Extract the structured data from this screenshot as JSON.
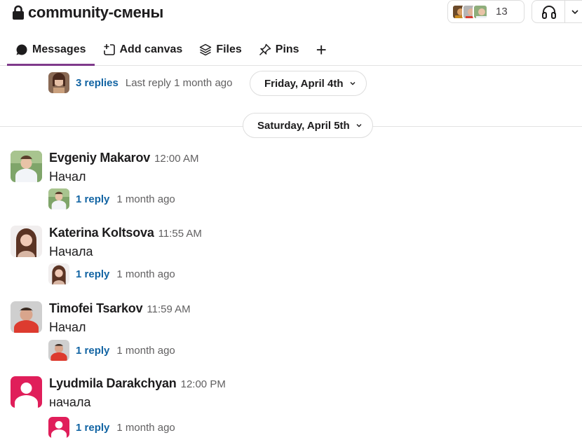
{
  "channel": {
    "name": "community-смены",
    "member_count": "13"
  },
  "tabs": [
    {
      "label": "Messages",
      "icon": "message-bubble-icon",
      "active": true
    },
    {
      "label": "Add canvas",
      "icon": "add-canvas-icon"
    },
    {
      "label": "Files",
      "icon": "files-stack-icon"
    },
    {
      "label": "Pins",
      "icon": "pin-icon"
    }
  ],
  "previous_thread": {
    "replies": "3 replies",
    "meta": "Last reply 1 month ago"
  },
  "date_pills": [
    "Friday, April 4th",
    "Saturday, April 5th"
  ],
  "messages": [
    {
      "author": "Evgeniy Makarov",
      "time": "12:00 AM",
      "text": "Начал",
      "replies": "1 reply",
      "meta": "1 month ago"
    },
    {
      "author": "Katerina Koltsova",
      "time": "11:55 AM",
      "text": "Начала",
      "replies": "1 reply",
      "meta": "1 month ago"
    },
    {
      "author": "Timofei Tsarkov",
      "time": "11:59 AM",
      "text": "Начал",
      "replies": "1 reply",
      "meta": "1 month ago"
    },
    {
      "author": "Lyudmila Darakchyan",
      "time": "12:00 PM",
      "text": "начала",
      "replies": "1 reply",
      "meta": "1 month ago"
    }
  ],
  "colors": {
    "link": "#1264a3",
    "active_tab": "#7f3a8b",
    "default_avatar": "#e01e5a"
  }
}
